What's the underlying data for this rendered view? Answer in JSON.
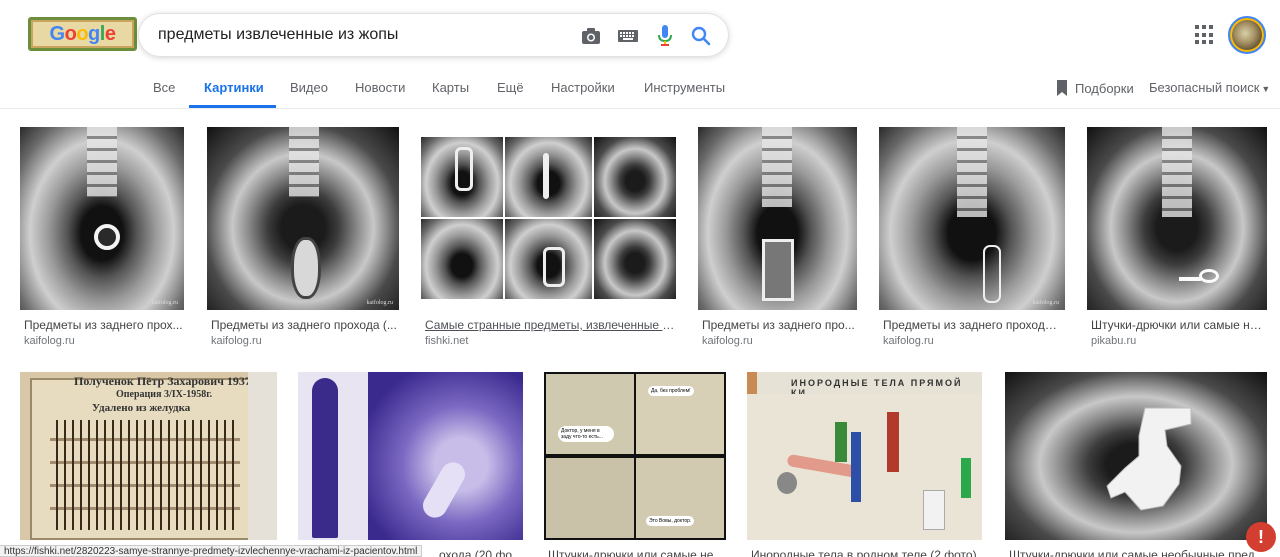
{
  "logo": {
    "text": "Google",
    "letters": [
      "G",
      "o",
      "o",
      "g",
      "l",
      "e"
    ]
  },
  "search": {
    "query": "предметы извлеченные из жопы",
    "camera_icon": "camera-icon",
    "keyboard_icon": "keyboard-icon",
    "mic_icon": "mic-icon",
    "search_icon": "search-icon"
  },
  "tabs": [
    "Все",
    "Картинки",
    "Видео",
    "Новости",
    "Карты",
    "Ещё",
    "Настройки",
    "Инструменты"
  ],
  "active_tab": "Картинки",
  "right_tools": {
    "collections": "Подборки",
    "safe_search": "Безопасный поиск"
  },
  "results_row1": [
    {
      "title": "Предметы из заднего прох...",
      "source": "kaifolog.ru",
      "label": "kaifolog.ru"
    },
    {
      "title": "Предметы из заднего прохода (...",
      "source": "kaifolog.ru",
      "label": "kaifolog.ru"
    },
    {
      "title": "Самые странные предметы, извлеченные в...",
      "source": "fishki.net"
    },
    {
      "title": "Предметы из заднего про...",
      "source": "kaifolog.ru",
      "label": "kaifolog.ru"
    },
    {
      "title": "Предметы из заднего прохода ...",
      "source": "kaifolog.ru",
      "label": "kaifolog.ru"
    },
    {
      "title": "Штучки-дрючки или самые не...",
      "source": "pikabu.ru"
    }
  ],
  "results_row2": [
    {
      "title": "",
      "plate_text": [
        "Полученок Пётр Захарович 1937г.",
        "Операция 3/IX-1958г.",
        "Удалено из желудка"
      ]
    },
    {
      "title": "...охода (20 фо..."
    },
    {
      "title": "Штучки-дрючки или самые не...",
      "bubbles": [
        "Да, без проблем!",
        "Доктор, у меня в заду что-то есть...",
        "Это Вовы, доктор."
      ]
    },
    {
      "title": "Инородные тела в родном теле (2 фото)",
      "plate_text": "ИНОРОДНЫЕ ТЕЛА ПРЯМОЙ КИ"
    },
    {
      "title": "Штучки-дрючки или самые необычные пред..."
    }
  ],
  "status_url": "https://fishki.net/2820223-samye-strannye-predmety-izvlechennye-vrachami-iz-pacientov.html",
  "alert_symbol": "!"
}
